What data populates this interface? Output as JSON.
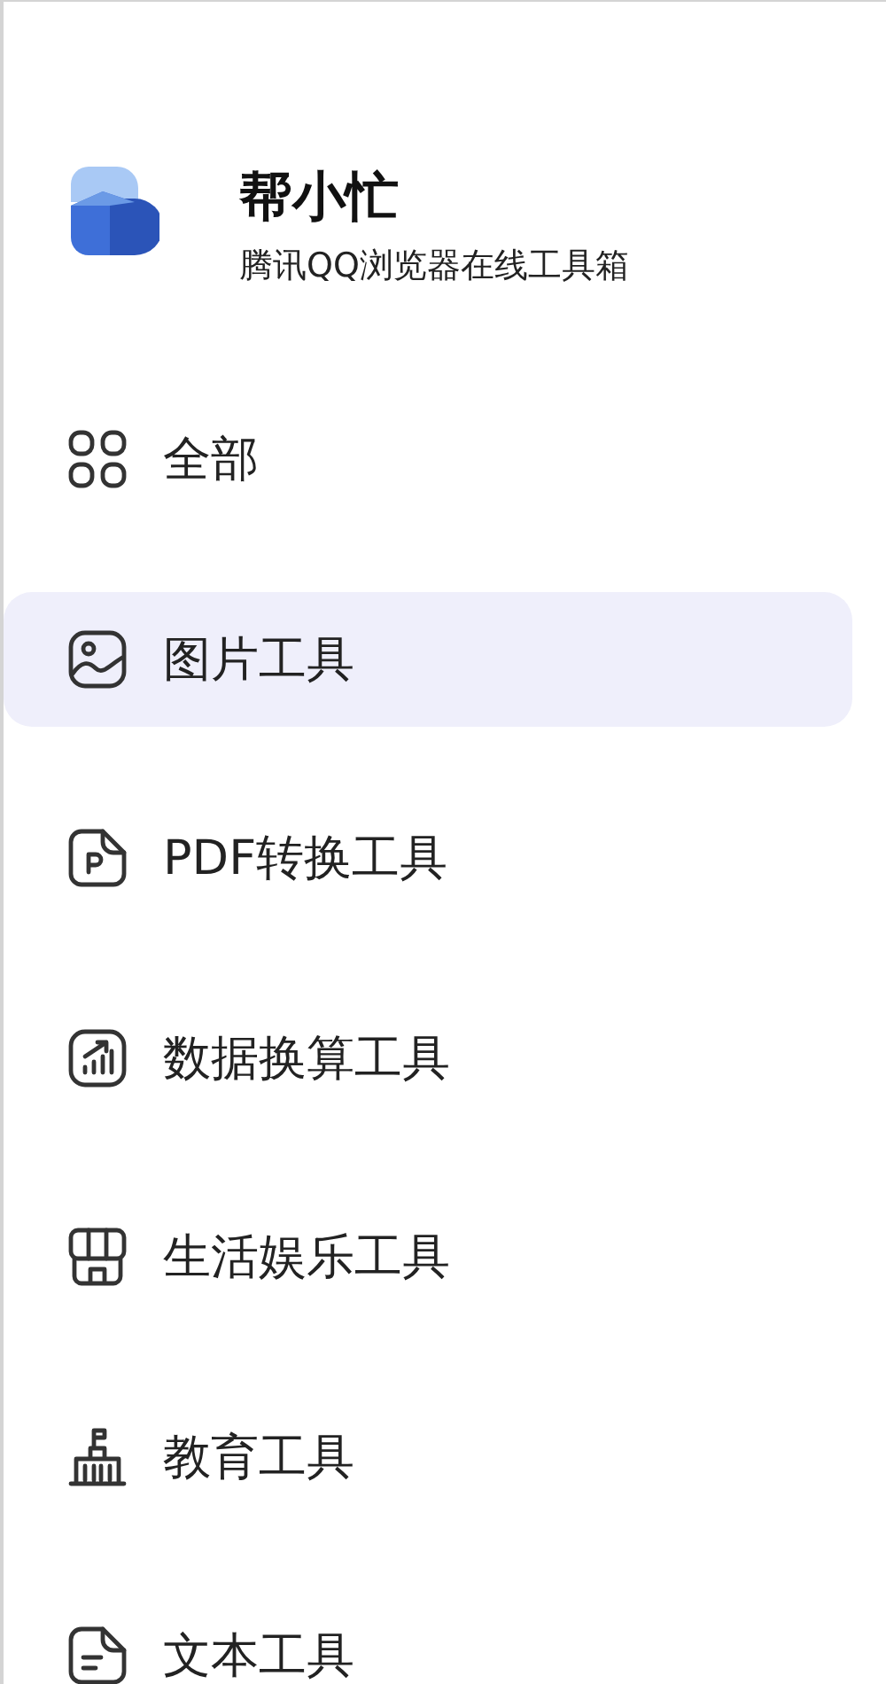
{
  "app": {
    "title": "帮小忙",
    "subtitle": "腾讯QQ浏览器在线工具箱"
  },
  "menu": [
    {
      "kind": "grid",
      "label": "全部",
      "selected": false
    },
    {
      "kind": "image",
      "label": "图片工具",
      "selected": true
    },
    {
      "kind": "pdf",
      "label": "PDF转换工具",
      "selected": false
    },
    {
      "kind": "chart",
      "label": "数据换算工具",
      "selected": false
    },
    {
      "kind": "store",
      "label": "生活娱乐工具",
      "selected": false
    },
    {
      "kind": "school",
      "label": "教育工具",
      "selected": false
    },
    {
      "kind": "doc",
      "label": "文本工具",
      "selected": false
    }
  ]
}
